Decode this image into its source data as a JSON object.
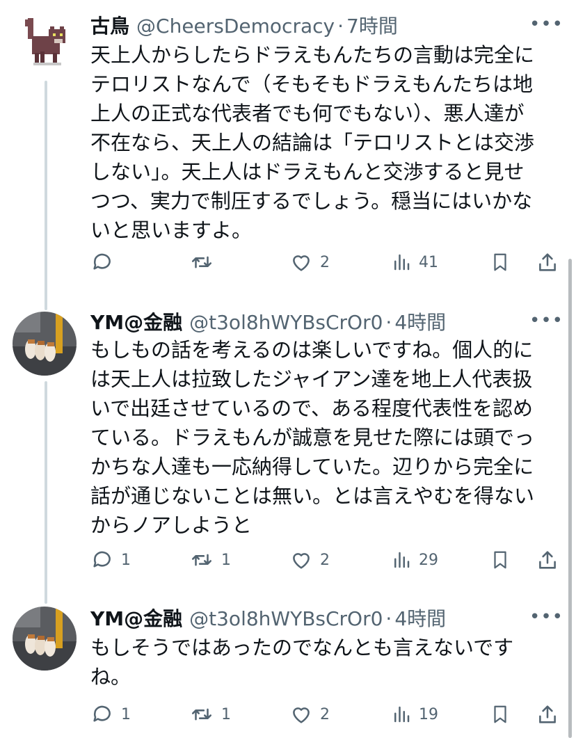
{
  "posts": [
    {
      "author": "古鳥",
      "handle": "@CheersDemocracy",
      "separator": "·",
      "time": "7時間",
      "more_icon": "more-horizontal-icon",
      "lines": [
        "天上人からしたらドラえもんたちの言動は完全に",
        "テロリストなんで（そもそもドラえもんたちは地",
        "上人の正式な代表者でも何でもない）、悪人達が",
        "不在なら、天上人の結論は「テロリストとは交渉",
        "しない」。天上人はドラえもんと交渉すると見せ",
        "つつ、実力で制圧するでしょう。穏当にはいかな",
        "いと思いますよ。"
      ],
      "replies": "",
      "reposts": "",
      "likes": "2",
      "views": "41"
    },
    {
      "author": "YM@金融",
      "handle": "@t3ol8hWYBsCrOr0",
      "separator": "·",
      "time": "4時間",
      "more_icon": "more-horizontal-icon",
      "lines": [
        "もしもの話を考えるのは楽しいですね。個人的に",
        "は天上人は拉致したジャイアン達を地上人代表扱",
        "いで出廷させているので、ある程度代表性を認め",
        "ている。ドラえもんが誠意を見せた際には頭でっ",
        "かちな人達も一応納得していた。辺りから完全に",
        "話が通じないことは無い。とは言えやむを得ない",
        "からノアしようと"
      ],
      "replies": "1",
      "reposts": "1",
      "likes": "2",
      "views": "29"
    },
    {
      "author": "YM@金融",
      "handle": "@t3ol8hWYBsCrOr0",
      "separator": "·",
      "time": "4時間",
      "more_icon": "more-horizontal-icon",
      "lines": [
        "もしそうではあったのでなんとも言えないです",
        "ね。"
      ],
      "replies": "1",
      "reposts": "1",
      "likes": "2",
      "views": "19"
    }
  ],
  "icons": {
    "reply": "reply-icon",
    "repost": "repost-icon",
    "like": "like-icon",
    "views": "views-icon",
    "bookmark": "bookmark-icon",
    "share": "share-icon"
  },
  "colors": {
    "text": "#0f1419",
    "secondary": "#536471",
    "thread_line": "#cfd9de"
  }
}
